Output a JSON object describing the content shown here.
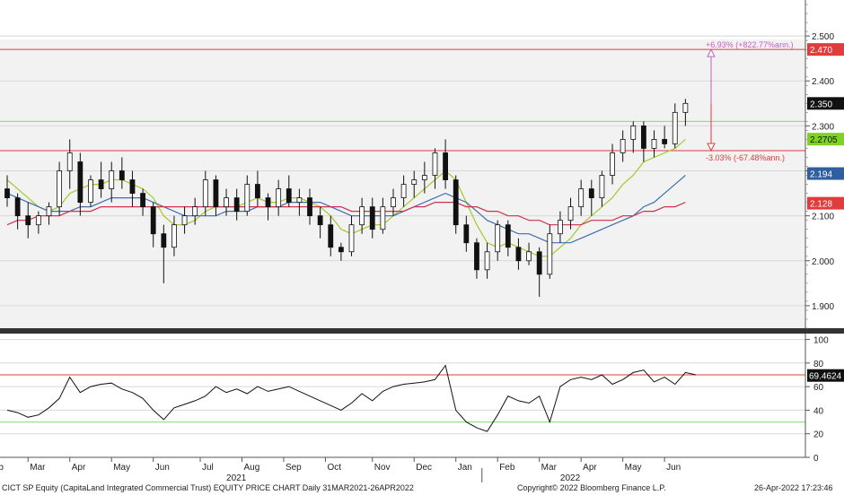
{
  "colors": {
    "background": "#ffffff",
    "panel_bg": "#f2f2f2",
    "grid": "#d8d8d8",
    "candle": "#111111",
    "ma_short": "#a3c92a",
    "ma_mid": "#3d6fb0",
    "ma_long": "#d0314a",
    "level_red": "#e23b3b",
    "level_green": "#7be06a",
    "rsi_line": "#111111",
    "annot_up": "#c060c0",
    "annot_down": "#e23b3b"
  },
  "chart_data": [
    {
      "type": "candlestick",
      "panel": "price",
      "ylim": [
        1.85,
        2.58
      ],
      "y_ticks": [
        "1.900",
        "2.000",
        "2.100",
        "2.200",
        "2.300",
        "2.400",
        "2.500"
      ],
      "x_domain": [
        0,
        67
      ],
      "series": [
        {
          "values": [
            [
              2.16,
              2.19,
              2.12,
              2.14
            ],
            [
              2.14,
              2.15,
              2.07,
              2.1
            ],
            [
              2.1,
              2.13,
              2.05,
              2.08
            ],
            [
              2.08,
              2.11,
              2.06,
              2.1
            ],
            [
              2.1,
              2.13,
              2.08,
              2.12
            ],
            [
              2.12,
              2.22,
              2.1,
              2.2
            ],
            [
              2.2,
              2.27,
              2.16,
              2.24
            ],
            [
              2.22,
              2.24,
              2.1,
              2.13
            ],
            [
              2.13,
              2.19,
              2.12,
              2.18
            ],
            [
              2.18,
              2.22,
              2.14,
              2.16
            ],
            [
              2.16,
              2.22,
              2.13,
              2.2
            ],
            [
              2.2,
              2.23,
              2.16,
              2.18
            ],
            [
              2.18,
              2.2,
              2.12,
              2.15
            ],
            [
              2.15,
              2.16,
              2.1,
              2.12
            ],
            [
              2.12,
              2.13,
              2.03,
              2.06
            ],
            [
              2.06,
              2.08,
              1.95,
              2.03
            ],
            [
              2.03,
              2.1,
              2.01,
              2.08
            ],
            [
              2.08,
              2.12,
              2.06,
              2.1
            ],
            [
              2.1,
              2.14,
              2.08,
              2.12
            ],
            [
              2.12,
              2.2,
              2.1,
              2.18
            ],
            [
              2.18,
              2.19,
              2.1,
              2.12
            ],
            [
              2.12,
              2.16,
              2.1,
              2.14
            ],
            [
              2.14,
              2.16,
              2.09,
              2.11
            ],
            [
              2.11,
              2.19,
              2.1,
              2.17
            ],
            [
              2.17,
              2.2,
              2.12,
              2.14
            ],
            [
              2.14,
              2.15,
              2.09,
              2.12
            ],
            [
              2.12,
              2.18,
              2.1,
              2.16
            ],
            [
              2.16,
              2.19,
              2.12,
              2.13
            ],
            [
              2.13,
              2.16,
              2.1,
              2.14
            ],
            [
              2.14,
              2.16,
              2.08,
              2.1
            ],
            [
              2.1,
              2.12,
              2.05,
              2.08
            ],
            [
              2.08,
              2.1,
              2.01,
              2.03
            ],
            [
              2.03,
              2.04,
              2.0,
              2.02
            ],
            [
              2.02,
              2.1,
              2.01,
              2.08
            ],
            [
              2.08,
              2.14,
              2.06,
              2.12
            ],
            [
              2.12,
              2.14,
              2.05,
              2.07
            ],
            [
              2.07,
              2.14,
              2.06,
              2.12
            ],
            [
              2.12,
              2.16,
              2.1,
              2.14
            ],
            [
              2.14,
              2.19,
              2.12,
              2.17
            ],
            [
              2.17,
              2.2,
              2.14,
              2.18
            ],
            [
              2.18,
              2.22,
              2.15,
              2.19
            ],
            [
              2.19,
              2.25,
              2.16,
              2.24
            ],
            [
              2.24,
              2.27,
              2.16,
              2.18
            ],
            [
              2.18,
              2.19,
              2.06,
              2.08
            ],
            [
              2.08,
              2.1,
              2.02,
              2.04
            ],
            [
              2.04,
              2.05,
              1.96,
              1.98
            ],
            [
              1.98,
              2.04,
              1.96,
              2.02
            ],
            [
              2.02,
              2.09,
              2.0,
              2.08
            ],
            [
              2.08,
              2.09,
              2.01,
              2.03
            ],
            [
              2.03,
              2.05,
              1.98,
              2.0
            ],
            [
              2.0,
              2.04,
              1.99,
              2.02
            ],
            [
              2.02,
              2.03,
              1.92,
              1.97
            ],
            [
              1.97,
              2.08,
              1.96,
              2.06
            ],
            [
              2.06,
              2.11,
              2.04,
              2.09
            ],
            [
              2.09,
              2.14,
              2.07,
              2.12
            ],
            [
              2.12,
              2.18,
              2.1,
              2.16
            ],
            [
              2.16,
              2.18,
              2.1,
              2.14
            ],
            [
              2.14,
              2.2,
              2.12,
              2.19
            ],
            [
              2.19,
              2.26,
              2.17,
              2.24
            ],
            [
              2.24,
              2.29,
              2.22,
              2.27
            ],
            [
              2.27,
              2.31,
              2.24,
              2.3
            ],
            [
              2.3,
              2.31,
              2.22,
              2.25
            ],
            [
              2.25,
              2.29,
              2.23,
              2.27
            ],
            [
              2.27,
              2.3,
              2.25,
              2.26
            ],
            [
              2.26,
              2.35,
              2.25,
              2.33
            ],
            [
              2.33,
              2.36,
              2.3,
              2.35
            ]
          ]
        },
        {
          "name": "",
          "values": [
            2.18,
            2.16,
            2.14,
            2.12,
            2.11,
            2.12,
            2.15,
            2.16,
            2.17,
            2.17,
            2.18,
            2.18,
            2.17,
            2.16,
            2.14,
            2.1,
            2.08,
            2.08,
            2.09,
            2.11,
            2.12,
            2.12,
            2.12,
            2.13,
            2.14,
            2.13,
            2.13,
            2.14,
            2.14,
            2.13,
            2.12,
            2.1,
            2.07,
            2.06,
            2.07,
            2.08,
            2.08,
            2.1,
            2.12,
            2.14,
            2.16,
            2.18,
            2.2,
            2.18,
            2.13,
            2.08,
            2.04,
            2.03,
            2.04,
            2.03,
            2.02,
            2.01,
            2.01,
            2.03,
            2.05,
            2.08,
            2.1,
            2.12,
            2.14,
            2.17,
            2.19,
            2.22,
            2.23,
            2.24,
            2.25,
            2.27
          ]
        },
        {
          "name": "",
          "values": [
            2.15,
            2.14,
            2.13,
            2.12,
            2.11,
            2.11,
            2.11,
            2.12,
            2.12,
            2.13,
            2.14,
            2.14,
            2.14,
            2.14,
            2.13,
            2.12,
            2.11,
            2.1,
            2.1,
            2.1,
            2.1,
            2.11,
            2.11,
            2.11,
            2.12,
            2.12,
            2.12,
            2.13,
            2.13,
            2.13,
            2.13,
            2.12,
            2.11,
            2.1,
            2.1,
            2.1,
            2.1,
            2.1,
            2.11,
            2.12,
            2.13,
            2.14,
            2.15,
            2.14,
            2.13,
            2.11,
            2.09,
            2.08,
            2.07,
            2.06,
            2.06,
            2.05,
            2.04,
            2.04,
            2.04,
            2.05,
            2.06,
            2.07,
            2.08,
            2.09,
            2.1,
            2.12,
            2.13,
            2.15,
            2.17,
            2.19
          ]
        },
        {
          "name": "",
          "values": [
            2.08,
            2.09,
            2.09,
            2.1,
            2.1,
            2.1,
            2.11,
            2.11,
            2.11,
            2.12,
            2.12,
            2.12,
            2.12,
            2.12,
            2.12,
            2.12,
            2.12,
            2.12,
            2.12,
            2.12,
            2.12,
            2.12,
            2.12,
            2.12,
            2.12,
            2.12,
            2.12,
            2.12,
            2.12,
            2.12,
            2.12,
            2.12,
            2.12,
            2.11,
            2.11,
            2.11,
            2.11,
            2.11,
            2.11,
            2.12,
            2.12,
            2.13,
            2.13,
            2.13,
            2.12,
            2.12,
            2.11,
            2.11,
            2.1,
            2.1,
            2.09,
            2.09,
            2.08,
            2.08,
            2.08,
            2.08,
            2.09,
            2.09,
            2.09,
            2.1,
            2.1,
            2.11,
            2.11,
            2.12,
            2.12,
            2.13
          ]
        }
      ],
      "hlines": [
        {
          "y": 2.47,
          "color": "#e23b3b",
          "label": "2.470"
        },
        {
          "y": 2.31,
          "color": "#7be06a"
        },
        {
          "y": 2.245,
          "color": "#e23b3b"
        }
      ],
      "price_labels": [
        {
          "y": 2.47,
          "text": "2.470",
          "bg": "#e23b3b",
          "fg": "#ffffff"
        },
        {
          "y": 2.35,
          "text": "2.350",
          "bg": "#111111",
          "fg": "#ffffff"
        },
        {
          "y": 2.2705,
          "text": "2.2705",
          "bg": "#7ed321",
          "fg": "#111111"
        },
        {
          "y": 2.194,
          "text": "2.194",
          "bg": "#2f5f9e",
          "fg": "#ffffff"
        },
        {
          "y": 2.128,
          "text": "2.128",
          "bg": "#e23b3b",
          "fg": "#ffffff"
        }
      ],
      "annotations": {
        "up_text": "+6.93% (+822.77%ann.)",
        "down_text": "-3.03% (-67.48%ann.)",
        "arrow_from": 2.35,
        "arrow_up_to": 2.47,
        "arrow_down_to": 2.245
      }
    },
    {
      "type": "line",
      "panel": "rsi",
      "ylim": [
        0,
        105
      ],
      "y_ticks": [
        "0",
        "20",
        "40",
        "60",
        "80",
        "100"
      ],
      "hlines": [
        {
          "y": 70,
          "color": "#e23b3b"
        },
        {
          "y": 30,
          "color": "#7be06a"
        }
      ],
      "series": [
        {
          "values": [
            40,
            38,
            34,
            36,
            42,
            50,
            68,
            55,
            60,
            62,
            63,
            58,
            55,
            50,
            40,
            32,
            42,
            45,
            48,
            52,
            60,
            55,
            58,
            54,
            60,
            56,
            58,
            60,
            56,
            52,
            48,
            44,
            40,
            46,
            54,
            48,
            56,
            60,
            62,
            63,
            64,
            66,
            78,
            40,
            30,
            25,
            22,
            36,
            52,
            48,
            46,
            52,
            30,
            60,
            66,
            68,
            66,
            70,
            62,
            66,
            72,
            74,
            64,
            68,
            62,
            72,
            70
          ]
        }
      ],
      "last_label": {
        "y": 69.4624,
        "text": "69.4624",
        "bg": "#111111",
        "fg": "#ffffff"
      }
    }
  ],
  "x_axis": {
    "months": [
      {
        "label": "Feb",
        "x": -2
      },
      {
        "label": "Mar",
        "x": 2
      },
      {
        "label": "Apr",
        "x": 6
      },
      {
        "label": "May",
        "x": 10
      },
      {
        "label": "Jun",
        "x": 14
      },
      {
        "label": "Jul",
        "x": 18.5
      },
      {
        "label": "Aug",
        "x": 22.5
      },
      {
        "label": "Sep",
        "x": 26.5
      },
      {
        "label": "Oct",
        "x": 30.5
      },
      {
        "label": "Nov",
        "x": 35
      },
      {
        "label": "Dec",
        "x": 39
      },
      {
        "label": "Jan",
        "x": 43
      },
      {
        "label": "Feb",
        "x": 47
      },
      {
        "label": "Mar",
        "x": 51
      },
      {
        "label": "Apr",
        "x": 55
      },
      {
        "label": "May",
        "x": 59
      },
      {
        "label": "Jun",
        "x": 63
      }
    ],
    "years": [
      {
        "label": "2021",
        "x": 21
      },
      {
        "label": "2022",
        "x": 53
      }
    ]
  },
  "footer": {
    "left": "CICT SP Equity (CapitaLand Integrated Commercial Trust) EQUITY PRICE CHART  Daily 31MAR2021-26APR2022",
    "middle": "Copyright© 2022 Bloomberg Finance L.P.",
    "right": "26-Apr-2022 17:23:46"
  }
}
